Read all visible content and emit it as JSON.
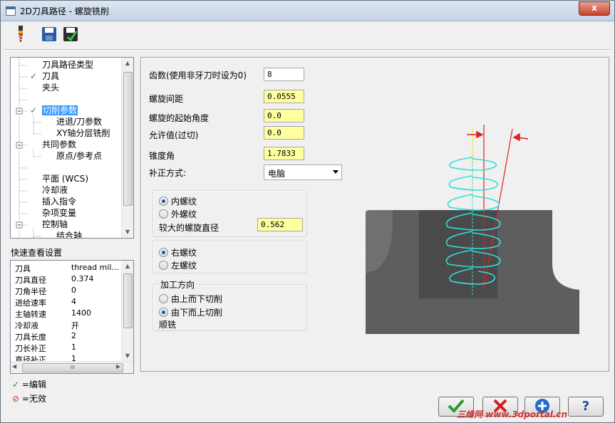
{
  "window": {
    "title": "2D刀具路径 - 螺旋铣削",
    "close_label": "x"
  },
  "toolbar": {
    "icons": [
      "tool-icon",
      "save-icon",
      "save-green-icon"
    ]
  },
  "tree": {
    "items": [
      {
        "label": "刀具路径类型",
        "checked": false
      },
      {
        "label": "刀具",
        "checked": true
      },
      {
        "label": "夹头",
        "checked": false
      },
      {
        "label": "切削参数",
        "checked": true,
        "selected": true
      },
      {
        "label": "进退/刀参数",
        "checked": false
      },
      {
        "label": "XY轴分层铣削",
        "checked": false
      },
      {
        "label": "共同参数",
        "checked": false
      },
      {
        "label": "原点/参考点",
        "checked": false
      },
      {
        "label": "平面 (WCS)",
        "checked": false
      },
      {
        "label": "冷却液",
        "checked": false
      },
      {
        "label": "插入指令",
        "checked": false
      },
      {
        "label": "杂项变量",
        "checked": false
      },
      {
        "label": "控制轴",
        "checked": false
      },
      {
        "label": "结合轴",
        "checked": false
      }
    ]
  },
  "quickview": {
    "title": "快速查看设置",
    "rows": [
      {
        "k": "刀具",
        "v": "thread mil..."
      },
      {
        "k": "刀具直径",
        "v": "0.374"
      },
      {
        "k": "刀角半径",
        "v": "0"
      },
      {
        "k": "进给速率",
        "v": "4"
      },
      {
        "k": "主轴转速",
        "v": "1400"
      },
      {
        "k": "冷却液",
        "v": "开"
      },
      {
        "k": "刀具长度",
        "v": "2"
      },
      {
        "k": "刀长补正",
        "v": "1"
      },
      {
        "k": "直径补正",
        "v": "1"
      }
    ],
    "scroll_mark": "III"
  },
  "legend": {
    "edit": "=编辑",
    "invalid": "=无效"
  },
  "params": {
    "teeth_label": "齿数(使用非牙刀时设为0)",
    "teeth_value": "8",
    "pitch_label": "螺旋间距",
    "pitch_value": "0.0555",
    "start_angle_label": "螺旋的起始角度",
    "start_angle_value": "0.0",
    "allowance_label": "允许值(过切)",
    "allowance_value": "0.0",
    "taper_label": "锥度角",
    "taper_value": "1.7833",
    "comp_label": "补正方式:",
    "comp_value": "电脑"
  },
  "thread_type": {
    "internal": "内螺纹",
    "external": "外螺纹",
    "major_dia_label": "较大的螺旋直径",
    "major_dia_value": "0.562"
  },
  "hand": {
    "right": "右螺纹",
    "left": "左螺纹"
  },
  "direction": {
    "title": "加工方向",
    "top_down": "由上而下切削",
    "bottom_up": "由下而上切削",
    "climb": "顺铣"
  },
  "buttons": {
    "ok": "ok",
    "cancel": "cancel",
    "add": "add",
    "help": "?"
  },
  "watermark": "三维网 www.3dportal.cn",
  "colors": {
    "selected": "#3399ff",
    "yellow_field": "#ffffa0",
    "helix": "#33dddd",
    "taper_line": "#e02020"
  }
}
